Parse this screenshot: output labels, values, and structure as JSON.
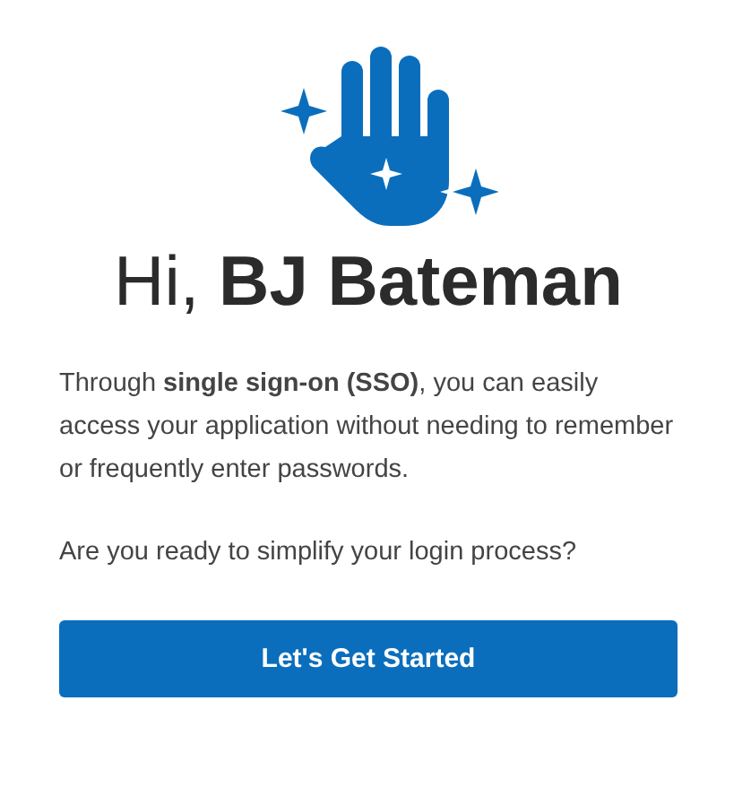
{
  "greeting": "Hi, **BJ Bateman**",
  "paragraphs": [
    "Through **single sign-on (SSO)**, you can easily access your application without needing to remember or frequently enter passwords.",
    "Are you ready to simplify your login process?"
  ],
  "button": {
    "label": "Let's Get Started"
  }
}
